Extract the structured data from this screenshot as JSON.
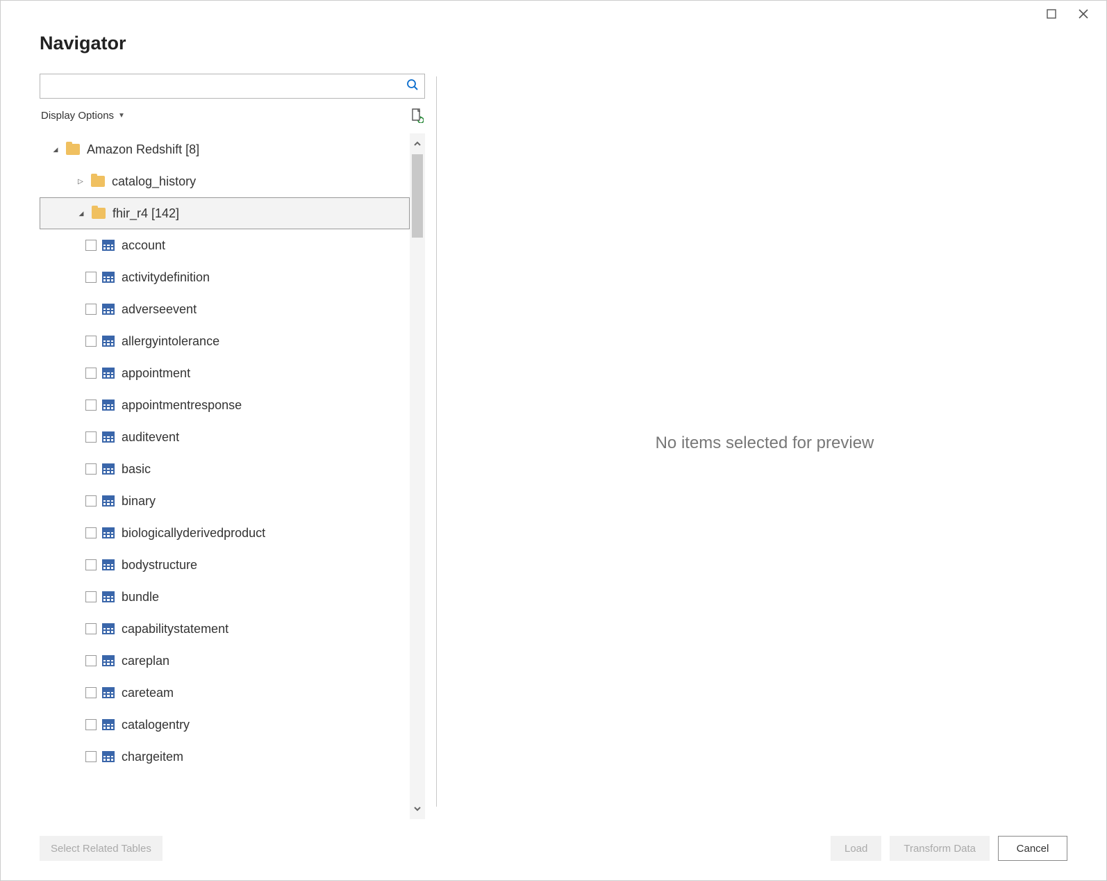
{
  "title": "Navigator",
  "search": {
    "placeholder": ""
  },
  "display_options_label": "Display Options",
  "tree": {
    "root": {
      "name": "Amazon Redshift [8]"
    },
    "schemas": [
      {
        "name": "catalog_history",
        "expanded": false,
        "selected": false
      },
      {
        "name": "fhir_r4 [142]",
        "expanded": true,
        "selected": true
      }
    ],
    "tables": [
      "account",
      "activitydefinition",
      "adverseevent",
      "allergyintolerance",
      "appointment",
      "appointmentresponse",
      "auditevent",
      "basic",
      "binary",
      "biologicallyderivedproduct",
      "bodystructure",
      "bundle",
      "capabilitystatement",
      "careplan",
      "careteam",
      "catalogentry",
      "chargeitem"
    ]
  },
  "preview": {
    "message": "No items selected for preview"
  },
  "footer": {
    "related": "Select Related Tables",
    "load": "Load",
    "transform": "Transform Data",
    "cancel": "Cancel"
  }
}
